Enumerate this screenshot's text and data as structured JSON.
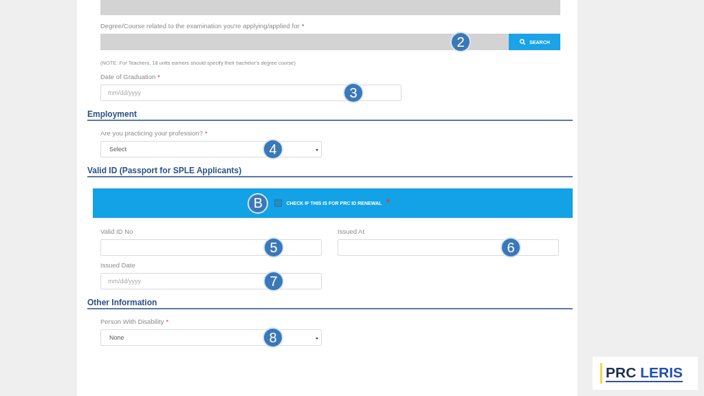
{
  "sections": [
    {
      "rows": [
        [
          {
            "kind": "readonly"
          }
        ],
        [
          {
            "kind": "search",
            "label": "Degree/Course related to the examination you're applying/applied for",
            "asterisk": "*",
            "marker": "2",
            "button": "SEARCH"
          }
        ],
        [
          {
            "kind": "note",
            "text": "(NOTE: For Teachers, 18 units earners should specify their bachelor's degree course)"
          }
        ],
        [
          {
            "kind": "date",
            "label": "Date of Graduation",
            "asterisk": "*",
            "placeholder": "mm/dd/yyyy",
            "marker": "3"
          }
        ]
      ]
    },
    {
      "heading": "Employment",
      "rows": [
        [
          {
            "kind": "select",
            "label": "Are you practicing your profession?",
            "asterisk": "*",
            "value": "Select",
            "marker": "4"
          }
        ]
      ]
    },
    {
      "heading": "Valid ID (Passport for SPLE Applicants)",
      "rows": [
        [
          {
            "kind": "checkbox-banner",
            "label": "CHECK IF THIS IS FOR PRC ID RENEWAL",
            "asterisk": "*",
            "checked": false,
            "marker": "B"
          }
        ],
        [
          {
            "kind": "text",
            "label": "Valid ID No",
            "marker": "5"
          },
          {
            "kind": "text",
            "label": "Issued At",
            "marker": "6"
          }
        ],
        [
          {
            "kind": "date",
            "label": "Issued Date",
            "placeholder": "mm/dd/yyyy",
            "marker": "7"
          }
        ]
      ]
    },
    {
      "heading": "Other Information",
      "rows": [
        [
          {
            "kind": "select",
            "label": "Person With Disability",
            "asterisk": "*",
            "value": "None",
            "marker": "8"
          }
        ]
      ]
    }
  ],
  "logo": {
    "prefix": "PRC",
    "name": "LERIS"
  }
}
